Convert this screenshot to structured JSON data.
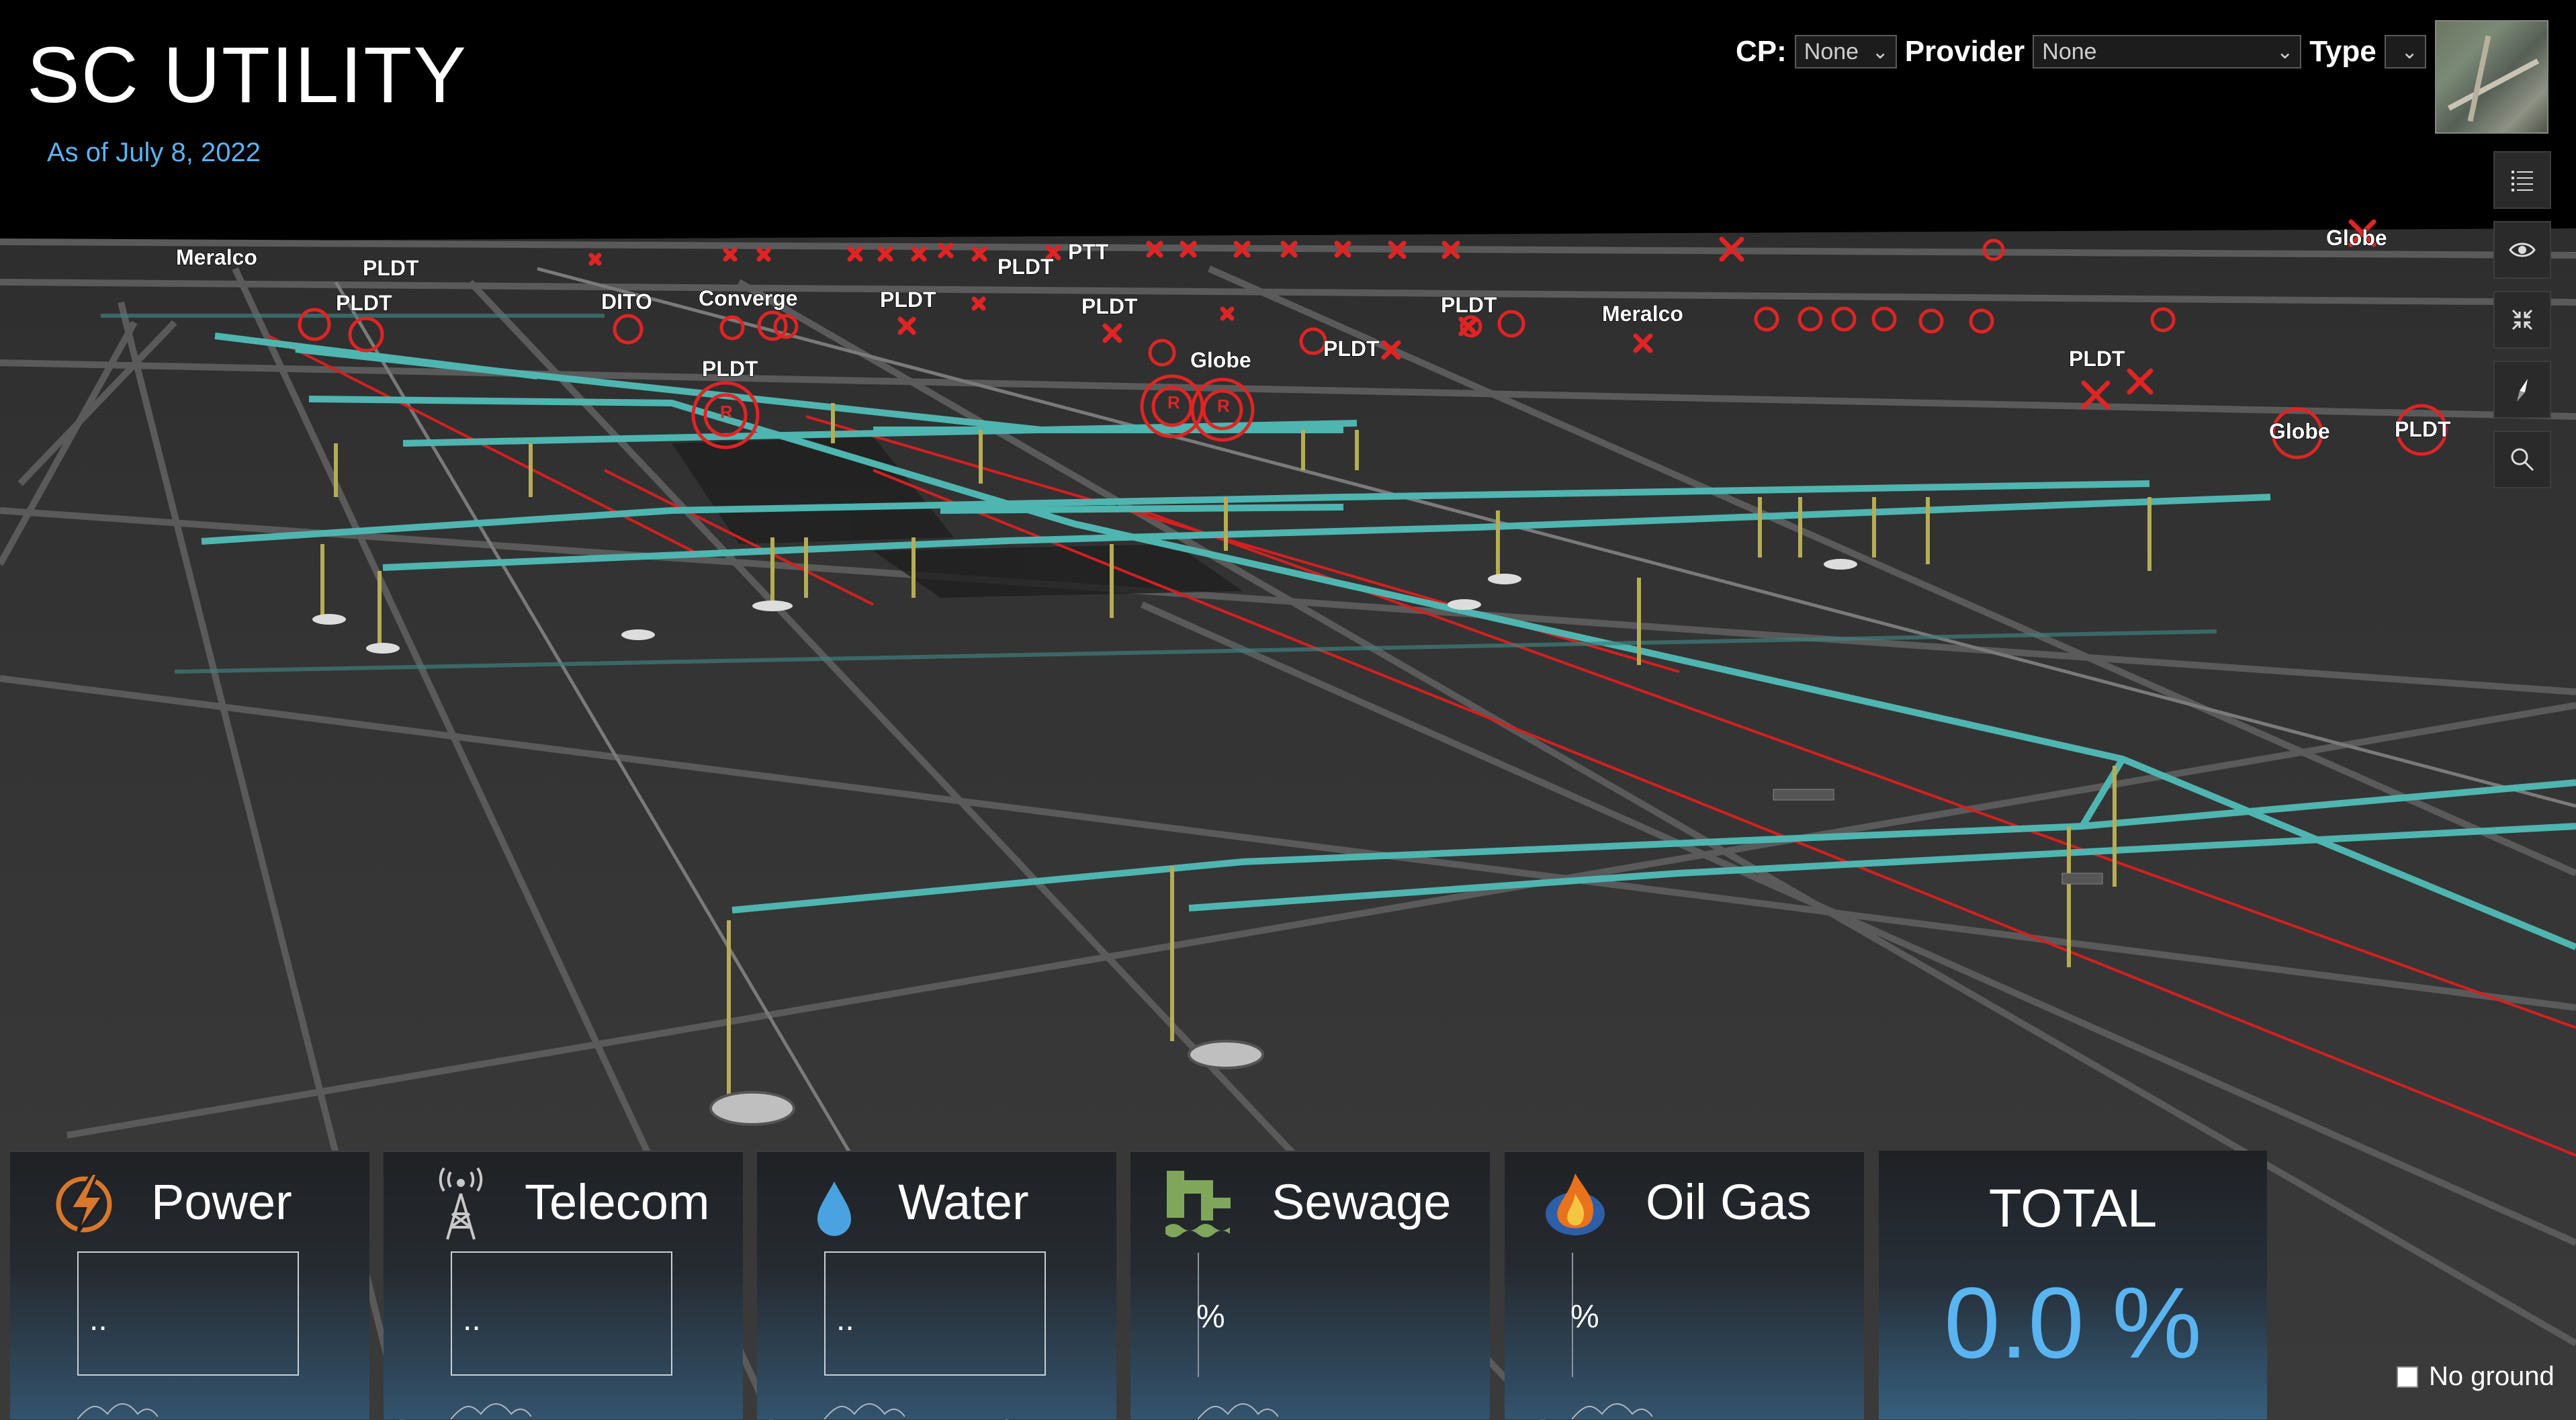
{
  "app": {
    "title": "SC UTILITY",
    "date": "As of July 8, 2022"
  },
  "filters": {
    "cp_label": "CP:",
    "cp_value": "None",
    "provider_label": "Provider",
    "provider_value": "None",
    "type_label": "Type",
    "type_value": ""
  },
  "toolbar": {
    "buttons": [
      "layer-list-icon",
      "eye-icon",
      "fullscreen-icon",
      "compass-icon",
      "search-icon"
    ]
  },
  "map": {
    "labels": [
      "Meralco",
      "PLDT",
      "PLDT",
      "DITO",
      "Converge",
      "PLDT",
      "PLDT",
      "PTT",
      "PLDT",
      "PLDT",
      "Globe",
      "PLDT",
      "PLDT",
      "Meralco",
      "PLDT",
      "Globe",
      "Globe",
      "PLDT"
    ],
    "colors": {
      "pipe": "#4fb5b0",
      "cable": "#d61f1f",
      "marker": "#e02424",
      "pole": "#b5ad55",
      "ground": "#333333"
    }
  },
  "cards": [
    {
      "label": "Power",
      "value": "..",
      "icon": "lightning-icon"
    },
    {
      "label": "Telecom",
      "value": "..",
      "icon": "antenna-tower-icon"
    },
    {
      "label": "Water",
      "value": "..",
      "icon": "water-drop-icon"
    },
    {
      "label": "Sewage",
      "value": "%",
      "icon": "sewage-icon"
    },
    {
      "label": "Oil Gas",
      "value": "%",
      "icon": "flame-icon"
    }
  ],
  "total": {
    "label": "TOTAL",
    "value": "0.0 %"
  },
  "ground_toggle": {
    "label": "No ground",
    "checked": false
  }
}
